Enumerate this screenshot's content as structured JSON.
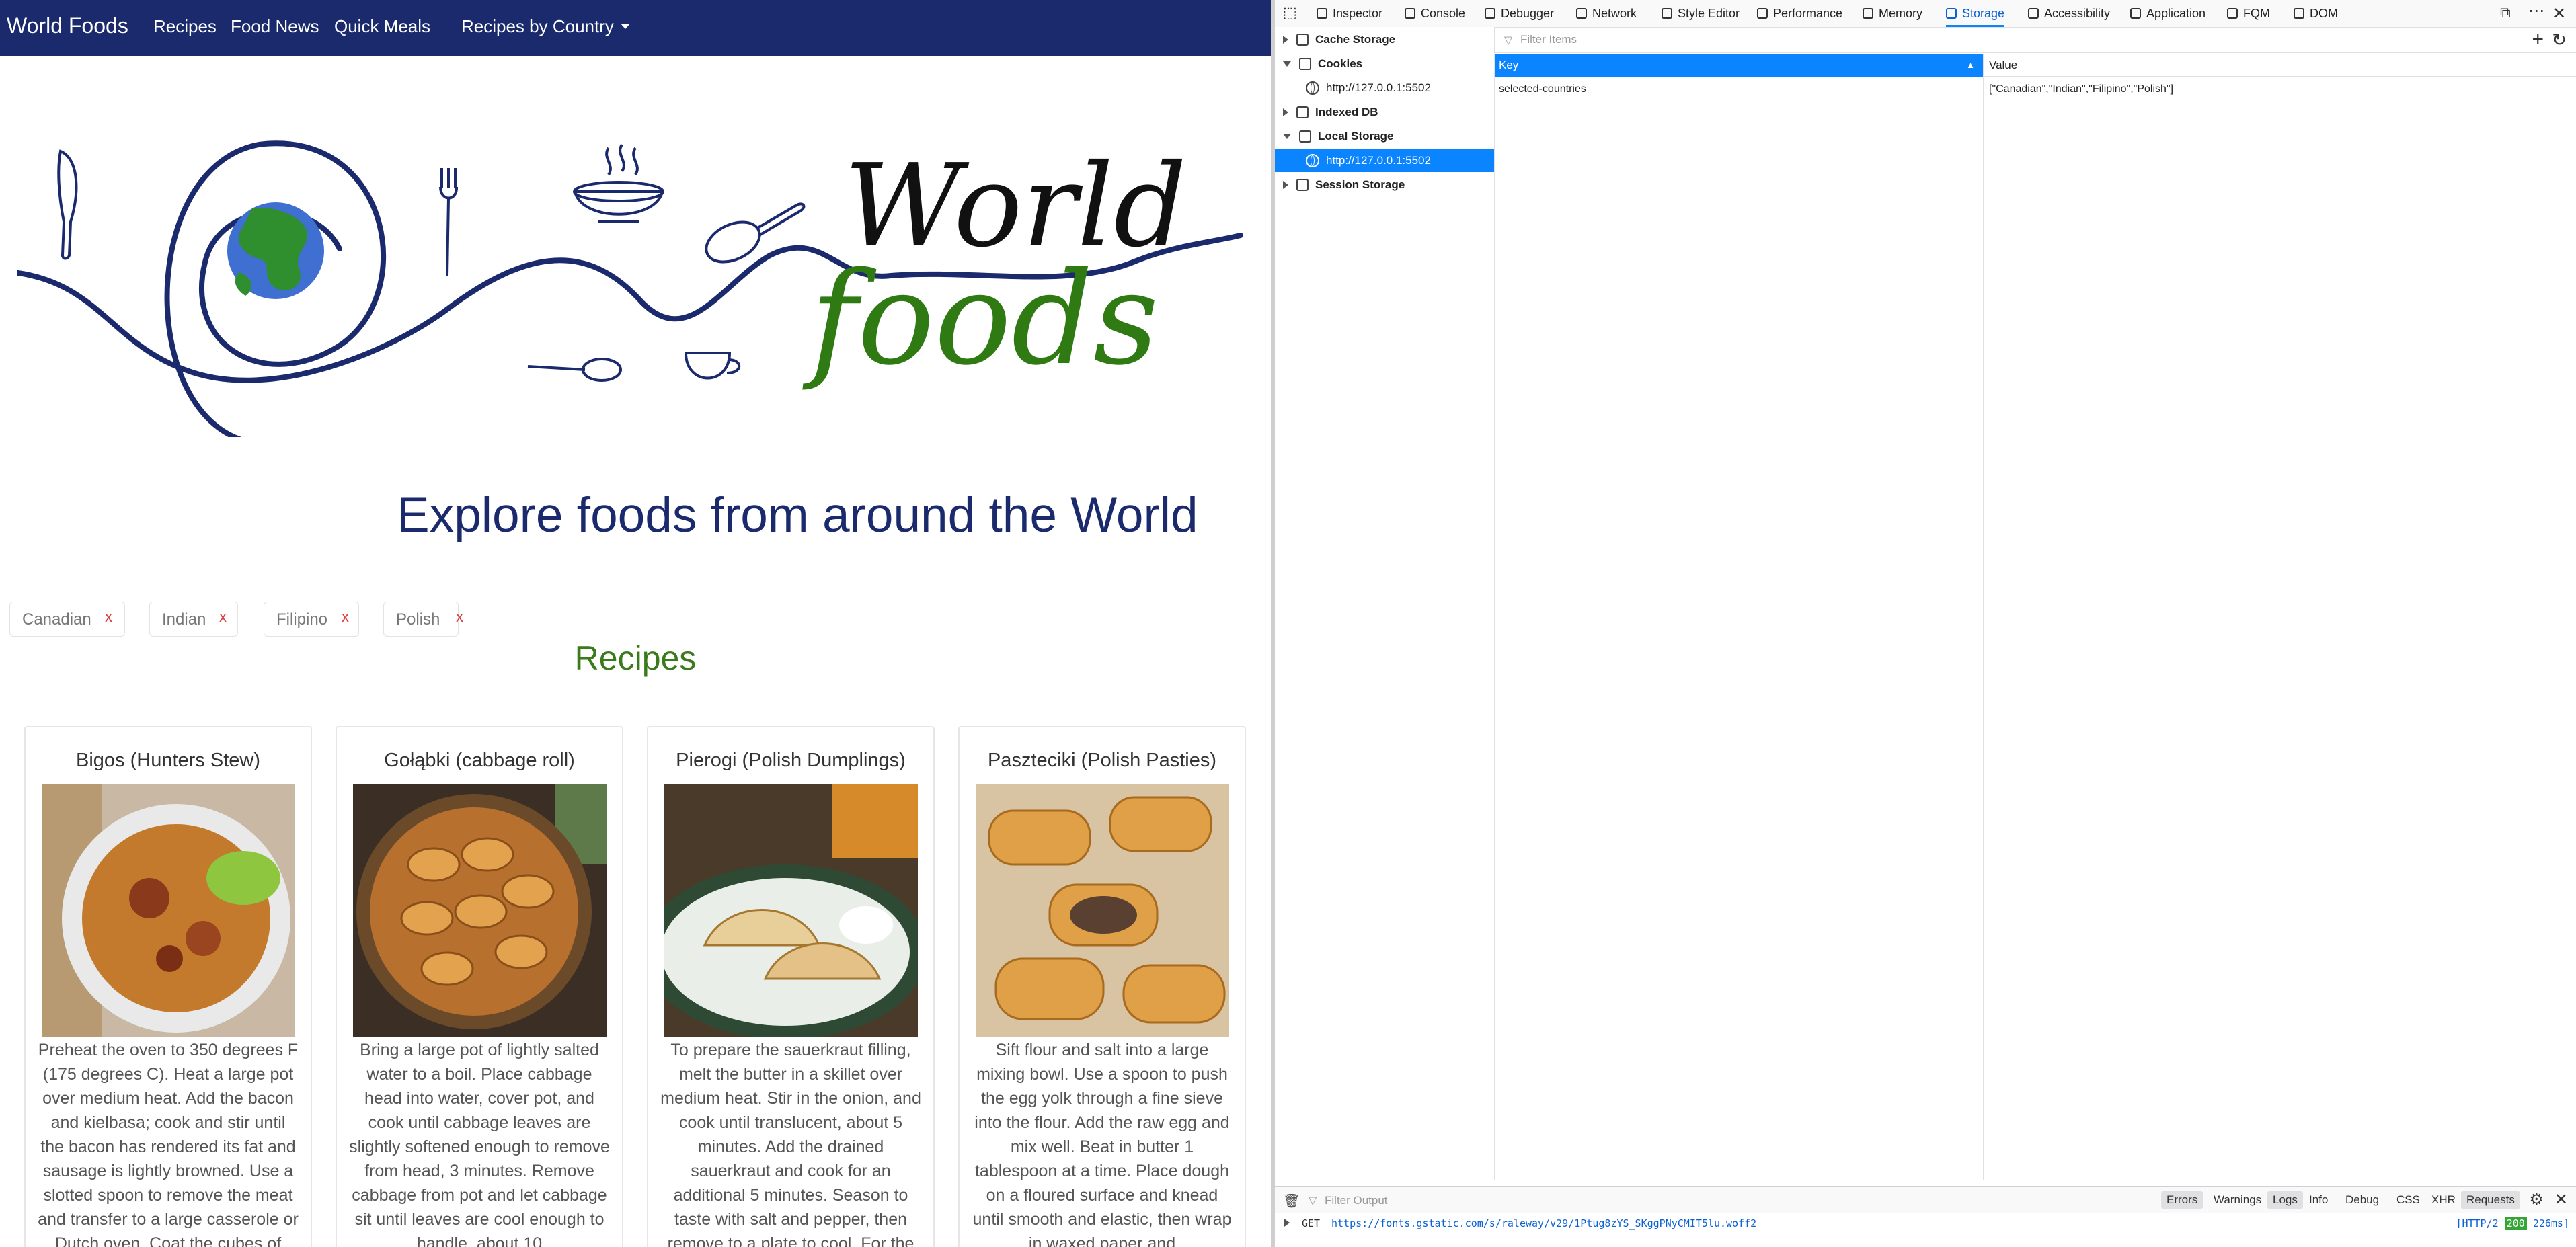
{
  "nav": {
    "brand": "World Foods",
    "links": [
      "Recipes",
      "Food News",
      "Quick Meals"
    ],
    "dropdown": "Recipes by Country"
  },
  "hero": {
    "logo_line1": "World",
    "logo_line2": "foods",
    "heading": "Explore foods from around the World"
  },
  "chips": [
    {
      "label": "Canadian",
      "remove": "x"
    },
    {
      "label": "Indian",
      "remove": "x"
    },
    {
      "label": "Filipino",
      "remove": "x"
    },
    {
      "label": "Polish",
      "remove": "x"
    }
  ],
  "section_title": "Recipes",
  "recipes": [
    {
      "title": "Bigos (Hunters Stew)",
      "text": "Preheat the oven to 350 degrees F (175 degrees C). Heat a large pot over medium heat. Add the bacon and kielbasa; cook and stir until the bacon has rendered its fat and sausage is lightly browned. Use a slotted spoon to remove the meat and transfer to a large casserole or Dutch oven. Coat the cubes of"
    },
    {
      "title": "Gołąbki (cabbage roll)",
      "text": "Bring a large pot of lightly salted water to a boil. Place cabbage head into water, cover pot, and cook until cabbage leaves are slightly softened enough to remove from head, 3 minutes. Remove cabbage from pot and let cabbage sit until leaves are cool enough to handle, about 10"
    },
    {
      "title": "Pierogi (Polish Dumplings)",
      "text": "To prepare the sauerkraut filling, melt the butter in a skillet over medium heat. Stir in the onion, and cook until translucent, about 5 minutes. Add the drained sauerkraut and cook for an additional 5 minutes. Season to taste with salt and pepper, then remove to a plate to cool. For the"
    },
    {
      "title": "Paszteciki (Polish Pasties)",
      "text": "Sift flour and salt into a large mixing bowl. Use a spoon to push the egg yolk through a fine sieve into the flour. Add the raw egg and mix well. Beat in butter 1 tablespoon at a time. Place dough on a floured surface and knead until smooth and elastic, then wrap in waxed paper and"
    }
  ],
  "devtools": {
    "tabs": [
      "Inspector",
      "Console",
      "Debugger",
      "Network",
      "Style Editor",
      "Performance",
      "Memory",
      "Storage",
      "Accessibility",
      "Application",
      "FQM",
      "DOM"
    ],
    "active_tab": "Storage",
    "tree": {
      "cache_storage": "Cache Storage",
      "cookies": "Cookies",
      "cookies_host": "http://127.0.0.1:5502",
      "indexed_db": "Indexed DB",
      "local_storage": "Local Storage",
      "local_storage_host": "http://127.0.0.1:5502",
      "session_storage": "Session Storage"
    },
    "filter_placeholder": "Filter Items",
    "table": {
      "col_key": "Key",
      "col_value": "Value",
      "row_key": "selected-countries",
      "row_value": "[\"Canadian\",\"Indian\",\"Filipino\",\"Polish\"]"
    },
    "console": {
      "filter_placeholder": "Filter Output",
      "buttons": [
        "Errors",
        "Warnings",
        "Logs",
        "Info",
        "Debug",
        "CSS",
        "XHR",
        "Requests"
      ],
      "log_method": "GET",
      "log_url": "https://fonts.gstatic.com/s/raleway/v29/1Ptug8zYS_SKggPNyCMIT5lu.woff2",
      "log_protocol": "[HTTP/2",
      "log_status": "200",
      "log_time": "226ms]"
    }
  },
  "colors": {
    "nav_bg": "#1a2a6c",
    "heading_blue": "#1a2a6c",
    "recipes_green": "#3a7a1b",
    "chip_x_red": "#d93a3a",
    "devtools_accent": "#0a84ff"
  }
}
